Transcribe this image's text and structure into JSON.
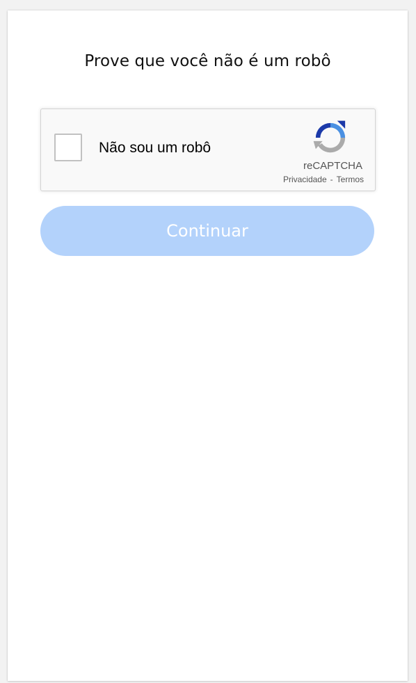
{
  "page": {
    "title": "Prove que você não é um robô"
  },
  "captcha": {
    "label": "Não sou um robô",
    "checked": false,
    "brand": "reCAPTCHA",
    "privacy_link": "Privacidade",
    "separator": "-",
    "terms_link": "Termos",
    "icon": "recaptcha-logo-icon"
  },
  "actions": {
    "continue_label": "Continuar",
    "continue_enabled": false
  },
  "colors": {
    "button_disabled_bg": "#b3d2fb",
    "logo_blue_dark": "#1c3aa9",
    "logo_blue": "#4a90e2",
    "logo_gray": "#ababab"
  }
}
